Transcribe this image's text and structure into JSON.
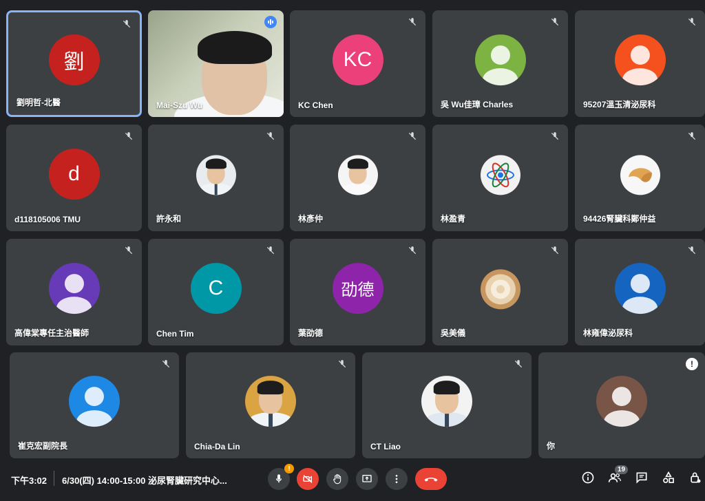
{
  "tiles": [
    {
      "name": "劉明哲-北醫",
      "initial": "劉",
      "color": "#c5221f"
    },
    {
      "name": "Mai-Szu Wu"
    },
    {
      "name": "KC Chen",
      "initial": "KC",
      "color": "#ec407a"
    },
    {
      "name": "吳 Wu佳璋 Charles",
      "color": "#7cb342"
    },
    {
      "name": "95207溫玉清泌尿科",
      "color": "#f4511e"
    },
    {
      "name": "d118105006 TMU",
      "initial": "d",
      "color": "#c5221f"
    },
    {
      "name": "許永和"
    },
    {
      "name": "林彥仲"
    },
    {
      "name": "林盈青"
    },
    {
      "name": "94426腎臟科鄭仲益"
    },
    {
      "name": "高偉棠專任主治醫師",
      "color": "#673ab7"
    },
    {
      "name": "Chen Tim",
      "initial": "C",
      "color": "#0097a7"
    },
    {
      "name": "葉劭德",
      "initial": "劭德",
      "color": "#8e24aa"
    },
    {
      "name": "吳美儀"
    },
    {
      "name": "林雍偉泌尿科",
      "color": "#1565c0"
    },
    {
      "name": "崔克宏副院長",
      "color": "#1e88e5"
    },
    {
      "name": "Chia-Da Lin"
    },
    {
      "name": "CT Liao"
    },
    {
      "name": "你",
      "color": "#795548"
    }
  ],
  "bottom": {
    "time": "下午3:02",
    "meeting": "6/30(四) 14:00-15:00 泌尿腎臟研究中心...",
    "participants_count": "19"
  },
  "colors": {
    "active_border": "#8ab4f8",
    "tile_bg": "#3c4043",
    "danger": "#ea4335"
  }
}
